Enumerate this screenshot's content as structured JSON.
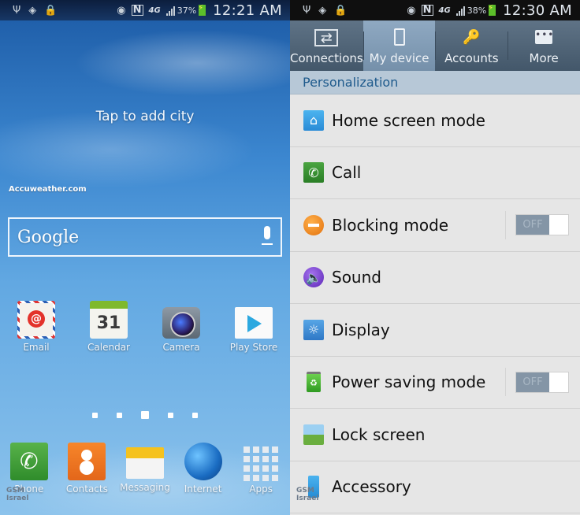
{
  "left_screen": {
    "status_bar": {
      "left_icons": [
        "usb-icon",
        "wifi-question-icon",
        "lock-warning-icon"
      ],
      "right_icons": [
        "smart-stay-eye-icon",
        "nfc-icon",
        "4g-icon",
        "signal-icon"
      ],
      "nfc_label": "N",
      "network_label": "4G",
      "battery_percent": "37%",
      "time": "12:21 AM"
    },
    "weather": {
      "prompt": "Tap to add city",
      "provider": "Accuweather.com"
    },
    "search": {
      "logo": "Google"
    },
    "apps": [
      {
        "label": "Email",
        "icon": "email-icon"
      },
      {
        "label": "Calendar",
        "icon": "calendar-icon",
        "day": "31"
      },
      {
        "label": "Camera",
        "icon": "camera-icon"
      },
      {
        "label": "Play Store",
        "icon": "play-store-icon"
      }
    ],
    "page_indicator": {
      "total": 5,
      "current": 3
    },
    "dock": [
      {
        "label": "Phone",
        "icon": "phone-icon"
      },
      {
        "label": "Contacts",
        "icon": "contacts-icon"
      },
      {
        "label": "Messaging",
        "icon": "messaging-icon"
      },
      {
        "label": "Internet",
        "icon": "internet-globe-icon"
      },
      {
        "label": "Apps",
        "icon": "apps-grid-icon"
      }
    ],
    "watermark": {
      "line1": "GSM",
      "line2": "Israel"
    }
  },
  "right_screen": {
    "status_bar": {
      "nfc_label": "N",
      "network_label": "4G",
      "battery_percent": "38%",
      "time": "12:30 AM"
    },
    "tabs": [
      {
        "label": "Connections",
        "icon": "connections-icon",
        "active": false
      },
      {
        "label": "My device",
        "icon": "device-icon",
        "active": true
      },
      {
        "label": "Accounts",
        "icon": "key-icon",
        "active": false
      },
      {
        "label": "More",
        "icon": "more-icon",
        "active": false
      }
    ],
    "section": "Personalization",
    "items": [
      {
        "label": "Home screen mode",
        "icon": "home-screen-icon"
      },
      {
        "label": "Call",
        "icon": "call-icon"
      },
      {
        "label": "Blocking mode",
        "icon": "blocking-icon",
        "toggle": "OFF"
      },
      {
        "label": "Sound",
        "icon": "sound-icon"
      },
      {
        "label": "Display",
        "icon": "display-icon"
      },
      {
        "label": "Power saving mode",
        "icon": "power-saving-icon",
        "toggle": "OFF"
      },
      {
        "label": "Lock screen",
        "icon": "lock-screen-icon"
      },
      {
        "label": "Accessory",
        "icon": "accessory-icon"
      }
    ],
    "watermark": {
      "line1": "GSM",
      "line2": "Israel"
    }
  }
}
